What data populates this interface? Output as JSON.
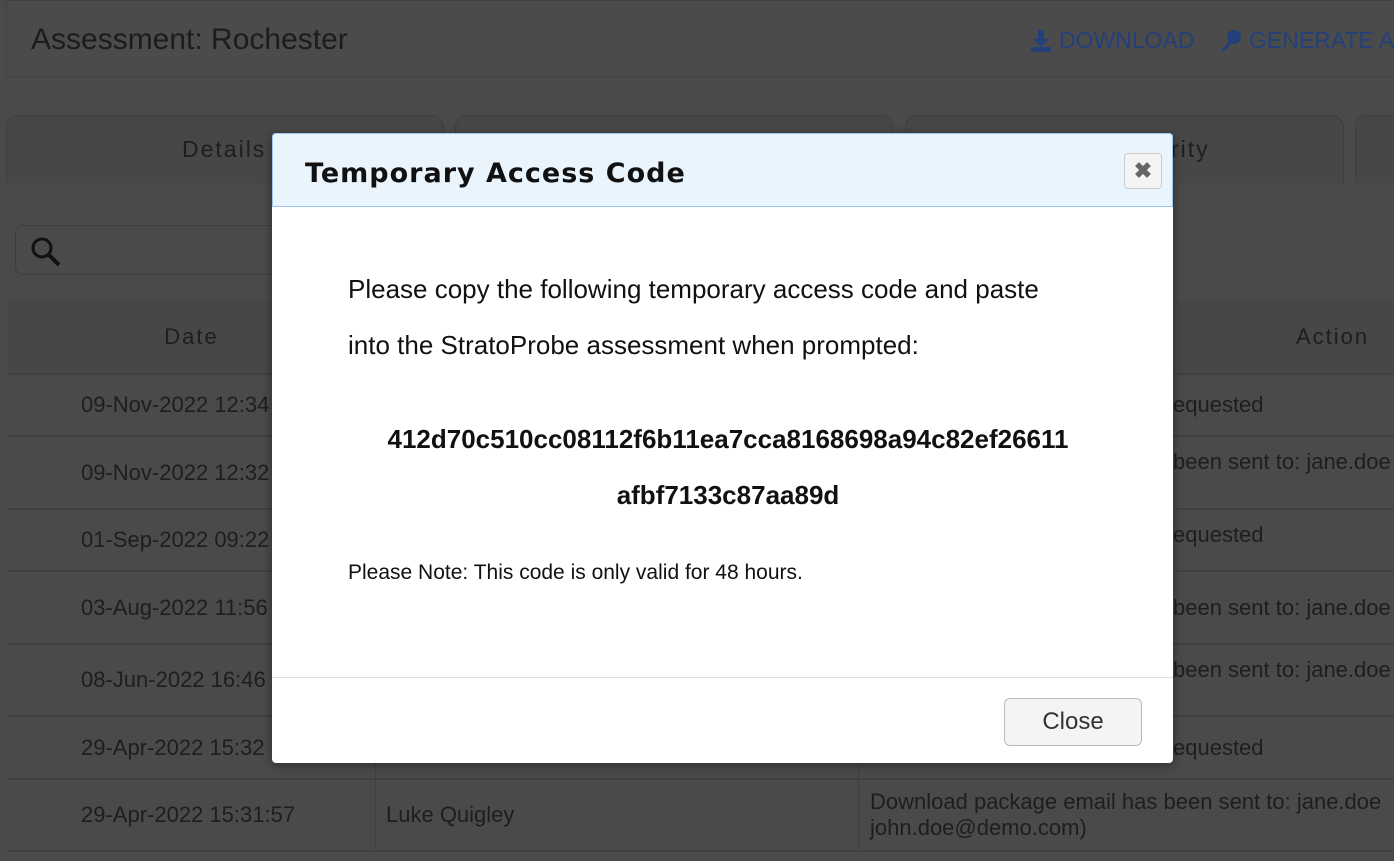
{
  "header": {
    "title": "Assessment: Rochester",
    "download": "DOWNLOAD",
    "generate": "GENERATE A",
    "download_icon": "download-icon",
    "key_icon": "key-icon",
    "accent": "#2a5db0"
  },
  "tabs": [
    "Details",
    "rity"
  ],
  "table": {
    "headers": [
      "Date",
      "Action"
    ],
    "rows": [
      {
        "date": "09-Nov-2022 12:34",
        "user": "",
        "action": "equested"
      },
      {
        "date": "09-Nov-2022 12:32",
        "user": "",
        "action": "been sent to: jane.doe"
      },
      {
        "date": "01-Sep-2022 09:22",
        "user": "",
        "action": "equested"
      },
      {
        "date": "03-Aug-2022 11:56",
        "user": "",
        "action": "been sent to: jane.doe"
      },
      {
        "date": "08-Jun-2022 16:46",
        "user": "",
        "action": "been sent to: jane.doe"
      },
      {
        "date": "29-Apr-2022 15:32",
        "user": "",
        "action": "equested"
      },
      {
        "date": "29-Apr-2022 15:31:57",
        "user": "Luke Quigley",
        "action": "Download package email has been sent to: jane.doe\njohn.doe@demo.com)"
      }
    ]
  },
  "modal": {
    "title": "Temporary Access Code",
    "close_icon": "close-icon",
    "line1": "Please copy the following temporary access code and paste",
    "line2": "into the StratoProbe assessment when prompted:",
    "code1": "412d70c510cc08112f6b11ea7cca8168698a94c82ef26611",
    "code2": "afbf7133c87aa89d",
    "note": "Please Note: This code is only valid for 48 hours.",
    "close": "Close"
  }
}
